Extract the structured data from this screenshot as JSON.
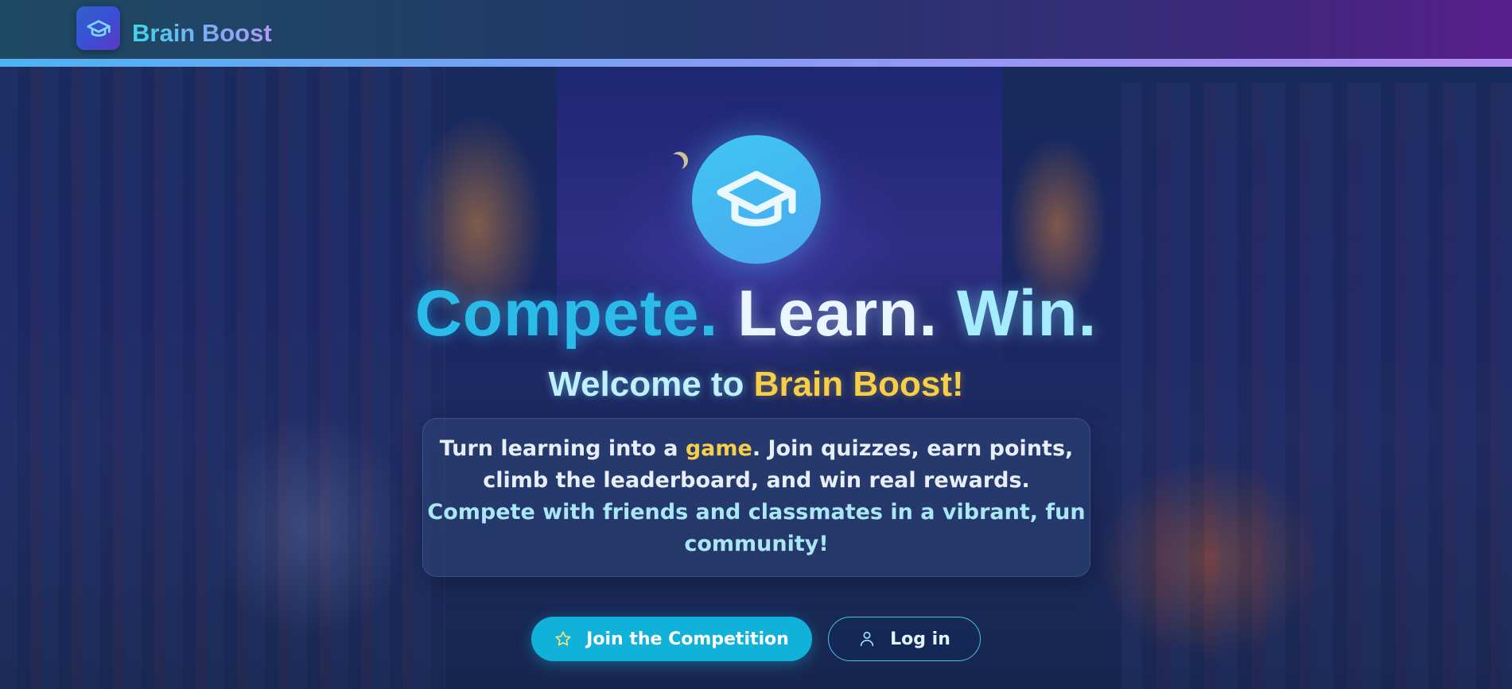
{
  "header": {
    "brand": "Brain Boost",
    "logo_icon": "graduation-cap-icon"
  },
  "hero": {
    "icon": "graduation-cap-icon",
    "headline": {
      "word1": "Compete.",
      "word2": "Learn.",
      "word3": "Win."
    },
    "welcome": {
      "prefix": "Welcome to ",
      "name": "Brain Boost!"
    },
    "description": {
      "line1_pre": "Turn learning into a ",
      "line1_highlight": "game",
      "line1_post": ". Join quizzes, earn points,",
      "line2": "climb the leaderboard, and win real rewards.",
      "line3": "Compete with friends and classmates in a vibrant, fun",
      "line4": "community!"
    }
  },
  "actions": {
    "join_label": "Join the Competition",
    "join_icon": "star-icon",
    "login_label": "Log in",
    "login_icon": "user-icon"
  },
  "colors": {
    "accent_cyan": "#11b2d9",
    "highlight_yellow": "#f6cf4a",
    "header_start": "#1f4a63",
    "header_end": "#571e8c"
  }
}
